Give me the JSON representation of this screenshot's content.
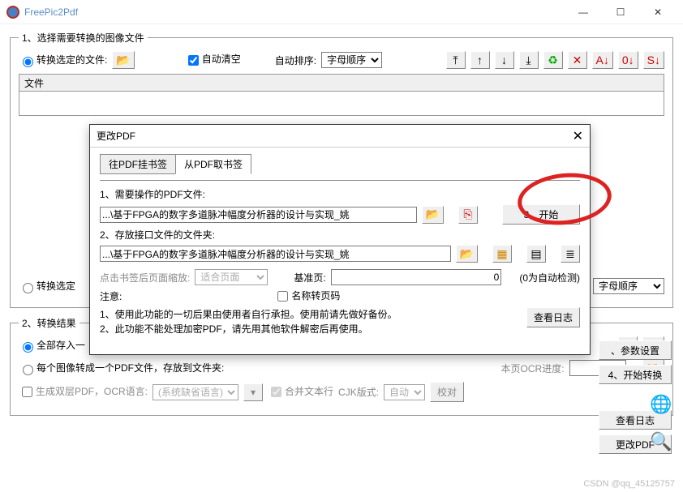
{
  "app": {
    "title": "FreePic2Pdf"
  },
  "section1": {
    "legend": "1、选择需要转换的图像文件",
    "opt_selected": "转换选定的文件:",
    "auto_clear": "自动清空",
    "auto_sort_label": "自动排序:",
    "auto_sort_value": "字母顺序",
    "list_header": "文件",
    "opt_folder": "转换选定",
    "sort2": "字母顺序"
  },
  "section2": {
    "legend": "2、转换结果",
    "save_one": "全部存入一",
    "per_image": "每个图像转成一个PDF文件，存放到文件夹:",
    "ocr_label": "本页OCR进度:",
    "gen_double": "生成双层PDF，OCR语言:",
    "ocr_lang": "(系统缺省语言)",
    "merge_text": "合并文本行",
    "cjk_label": "CJK版式:",
    "cjk_value": "自动",
    "proof": "校对"
  },
  "rightbuttons": {
    "params": "、参数设置",
    "start": "4、开始转换",
    "viewlog": "查看日志",
    "changepdf": "更改PDF"
  },
  "dialog": {
    "title": "更改PDF",
    "tab1": "往PDF挂书签",
    "tab2": "从PDF取书签",
    "label1": "1、需要操作的PDF文件:",
    "path1": "...\\基于FPGA的数字多道脉冲幅度分析器的设计与实现_姚",
    "start_btn": "3、开始",
    "label2": "2、存放接口文件的文件夹:",
    "path2": "...\\基于FPGA的数字多道脉冲幅度分析器的设计与实现_姚",
    "zoom_label": "点击书签后页面缩放:",
    "zoom_value": "适合页面",
    "basepage_label": "基准页:",
    "basepage_value": "0",
    "basepage_hint": "(0为自动检测)",
    "recode": "名称转页码",
    "notice_label": "注意:",
    "notice1": "1、使用此功能的一切后果由使用者自行承担。使用前请先做好备份。",
    "notice2": "2、此功能不能处理加密PDF，请先用其他软件解密后再使用。",
    "viewlog": "查看日志"
  },
  "watermark": "CSDN @qq_45125757"
}
